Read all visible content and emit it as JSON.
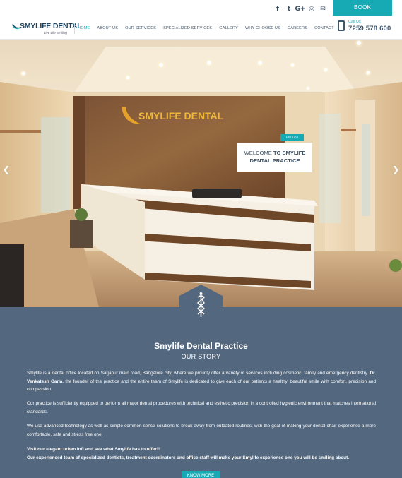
{
  "topbar": {
    "social_icons": [
      "facebook-icon",
      "twitter-icon",
      "google-plus-icon",
      "instagram-icon",
      "mail-icon"
    ],
    "social_glyphs": [
      "f",
      "t",
      "G+",
      "◎",
      "✉"
    ],
    "book_label": "BOOK APPOINTMENT"
  },
  "header": {
    "brand": "SMYLIFE DENTAL",
    "tagline": "Live Life Smiling",
    "nav": [
      "HOME",
      "ABOUT US",
      "OUR SERVICES",
      "SPECIALIZED SERVICES",
      "GALLERY",
      "WHY CHOOSE US",
      "CAREERS",
      "CONTACT"
    ],
    "active_nav": "HOME",
    "call_label": "Call Us",
    "call_number": "7259 578 600"
  },
  "hero": {
    "wall_sign": "SMYLIFE DENTAL",
    "prev_arrow": "❮",
    "next_arrow": "❯",
    "tag": "HELLO !",
    "welcome_line1_plain": "WELCOME ",
    "welcome_line1_bold": "TO SMYLIFE",
    "welcome_line2": "DENTAL PRACTICE"
  },
  "story": {
    "title": "Smylife Dental Practice",
    "subtitle": "OUR STORY",
    "p1_a": "Smylife is a dental office located on Sarjapur main road, Bangalore city, where we proudly offer a variety of services including cosmetic, family and emergency dentistry. ",
    "p1_bold": "Dr. Venkatesh Garla",
    "p1_b": ", the founder of the practice and the entire team of Smylife is dedicated to give each of our patients a healthy, beautiful smile with comfort, precision and compassion.",
    "p2": "Our practice is sufficiently equipped to perform all major dental procedures with technical and esthetic precision in a controlled hygienic environment that matches international standards.",
    "p3": "We use advanced technology as well as simple common sense solutions to break away from outdated routines, with the goal of making your dental chair experience a more comfortable, safe and stress free one.",
    "p4_line1": "Visit our elegant urban loft and see what Smylife has to offer!!",
    "p4_line2": "Our experienced team of specialized dentists, treatment coordinators and office staff will make your Smylife experience one you will be smiling about.",
    "more_label": "KNOW MORE"
  },
  "colors": {
    "accent": "#17a9b4",
    "navy": "#40566b",
    "section_bg": "#53677e"
  }
}
